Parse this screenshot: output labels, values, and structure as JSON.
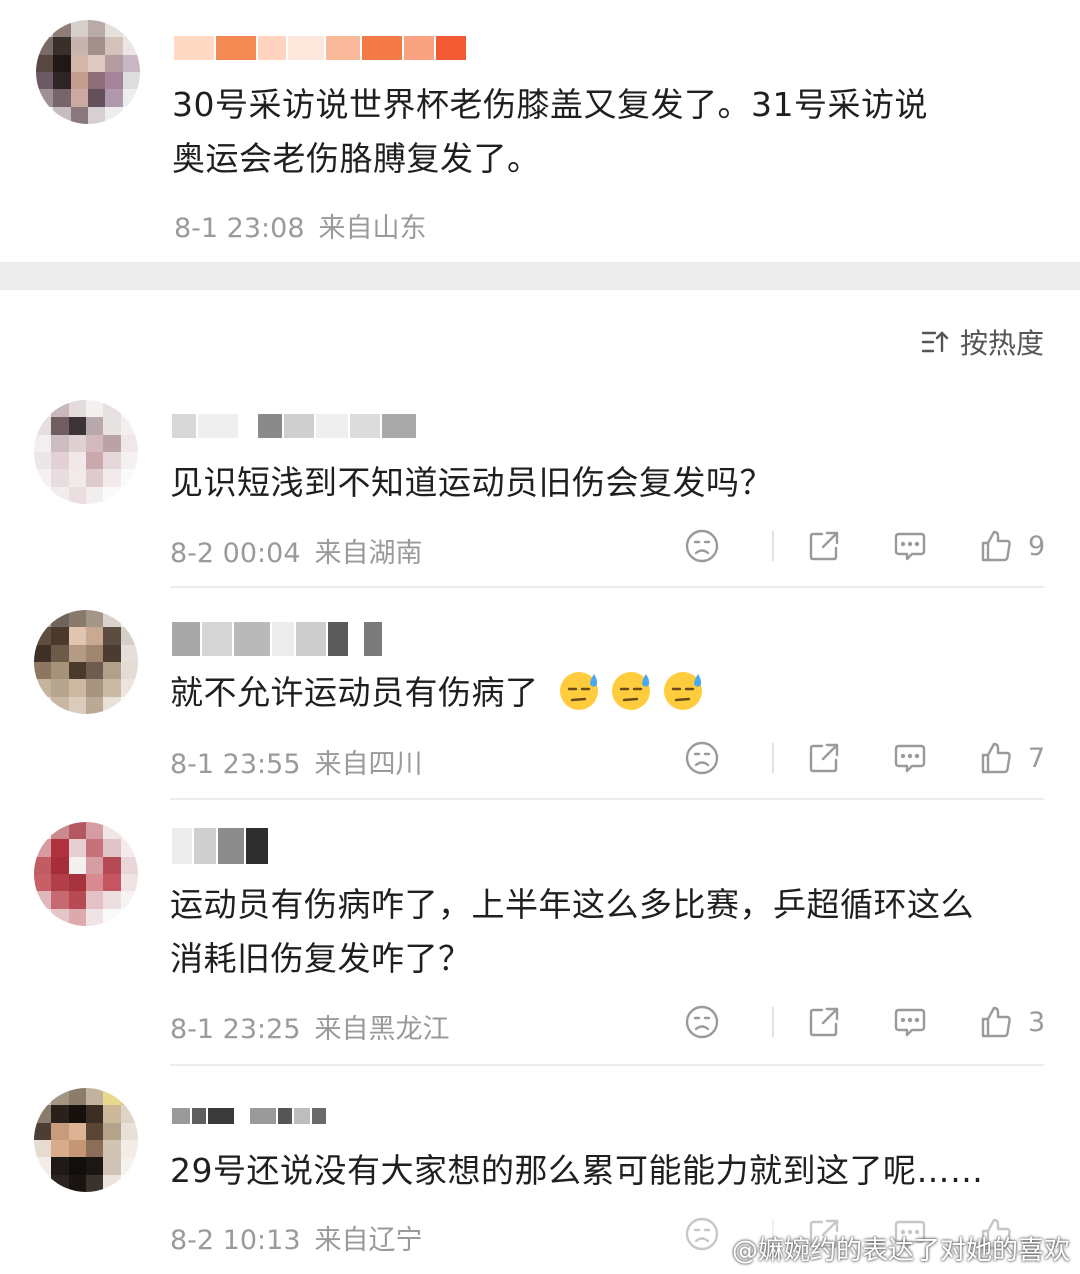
{
  "top_comment": {
    "text_line1": "30号采访说世界杯老伤膝盖又复发了。31号采访说",
    "text_line2": "奥运会老伤胳膊复发了。",
    "time": "8-1 23:08",
    "location": "来自山东"
  },
  "sort": {
    "label": "按热度",
    "icon": "sort-icon"
  },
  "comments": [
    {
      "text_line1": "见识短浅到不知道运动员旧伤会复发吗？",
      "time": "8-2 00:04",
      "location": "来自湖南",
      "likes": "9"
    },
    {
      "text_line1": "就不允许运动员有伤病了",
      "time": "8-1 23:55",
      "location": "来自四川",
      "likes": "7",
      "emoji": "😓😓😓"
    },
    {
      "text_line1": "运动员有伤病咋了，上半年这么多比赛，乒超循环这么",
      "text_line2": "消耗旧伤复发咋了？",
      "time": "8-1 23:25",
      "location": "来自黑龙江",
      "likes": "3"
    },
    {
      "text_line1": "29号还说没有大家想的那么累可能能力就到这了呢……",
      "time": "8-2 10:13",
      "location": "来自辽宁",
      "likes": ""
    }
  ],
  "watermark": "@嫲婉约的表达了对她的喜欢",
  "colors": {
    "text": "#1f1f1f",
    "meta": "#9a9a9a",
    "divider": "#ececec"
  }
}
